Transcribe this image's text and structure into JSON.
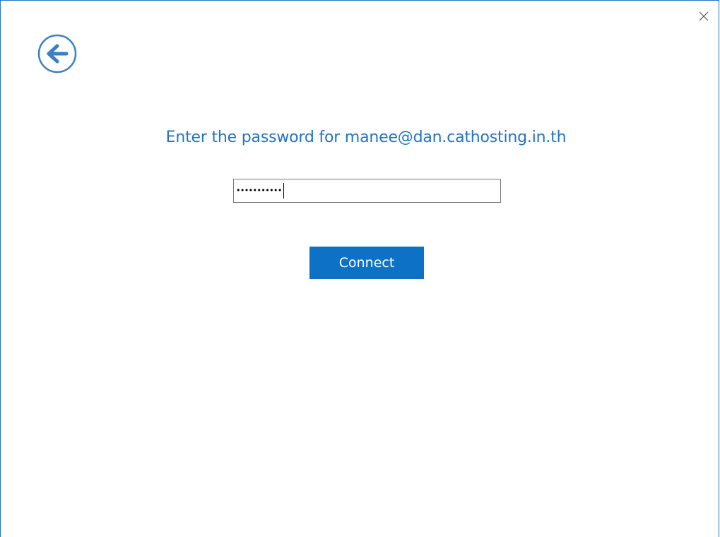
{
  "dialog": {
    "prompt": "Enter the password for manee@dan.cathosting.in.th",
    "password_masked": "•••••••••••",
    "connect_label": "Connect",
    "icons": {
      "close": "close-icon",
      "back": "back-arrow-icon"
    },
    "colors": {
      "accent": "#1f74c7",
      "button": "#0d72c6",
      "button_text": "#ffffff",
      "field_border": "#7a7a7a"
    }
  }
}
